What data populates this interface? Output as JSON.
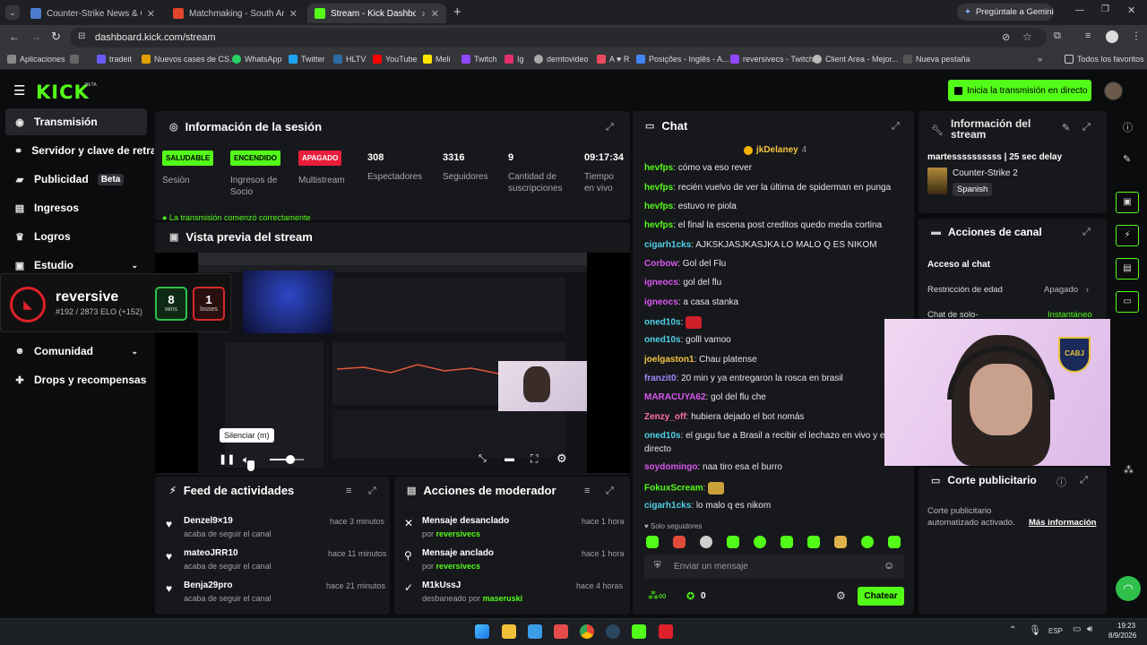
{
  "browser": {
    "tabs": [
      {
        "title": "Counter-Strike News & Coverag",
        "color": "#4a7bd0"
      },
      {
        "title": "Matchmaking - South America",
        "color": "#e0462c"
      },
      {
        "title": "Stream - Kick Dashboard",
        "color": "#53fc18"
      }
    ],
    "gemini": "Pregúntale a Gemini",
    "url": "dashboard.kick.com/stream",
    "bookmarks": [
      {
        "label": "Aplicaciones",
        "color": "#888"
      },
      {
        "label": "tradeit",
        "color": "#6a5af9"
      },
      {
        "label": "Nuevos cases de CS...",
        "color": "#e0a100"
      },
      {
        "label": "WhatsApp",
        "color": "#25d366"
      },
      {
        "label": "Twitter",
        "color": "#1da1f2"
      },
      {
        "label": "HLTV",
        "color": "#2d6da3"
      },
      {
        "label": "YouTube",
        "color": "#ff0000"
      },
      {
        "label": "Meli",
        "color": "#ffe600"
      },
      {
        "label": "Twitch",
        "color": "#9146ff"
      },
      {
        "label": "Ig",
        "color": "#e1306c"
      },
      {
        "label": "demtovideo",
        "color": "#aaaaaa"
      },
      {
        "label": "A ♥ R",
        "color": "#e84a5f"
      },
      {
        "label": "Posições - Inglês - A...",
        "color": "#4285f4"
      },
      {
        "label": "reversivecs - Twitch",
        "color": "#9146ff"
      },
      {
        "label": "Client Area - Mejor...",
        "color": "#bbbbbb"
      },
      {
        "label": "Nueva pestaña",
        "color": "#555555"
      }
    ],
    "all_bookmarks": "Todos los favoritos"
  },
  "header": {
    "logo": "KICK",
    "logo_sup": "BETA",
    "go_live": "Inicia la transmisión en directo"
  },
  "sidebar": {
    "items": [
      {
        "label": "Transmisión",
        "icon": "broadcast-icon"
      },
      {
        "label": "Servidor y clave de retransmisión",
        "icon": "link-icon"
      },
      {
        "label": "Publicidad",
        "icon": "ads-icon",
        "badge": "Beta"
      },
      {
        "label": "Ingresos",
        "icon": "revenue-icon"
      },
      {
        "label": "Logros",
        "icon": "trophy-icon"
      },
      {
        "label": "Estudio",
        "icon": "studio-icon"
      },
      {
        "label": "Comunidad",
        "icon": "community-icon"
      },
      {
        "label": "Drops y recompensas",
        "icon": "gift-icon"
      }
    ]
  },
  "faceit_overlay": {
    "name": "reversive",
    "elo": "#192 / 2873 ELO (+152)",
    "wins": "8",
    "wins_label": "wins",
    "losses": "1",
    "losses_label": "losses"
  },
  "session": {
    "title": "Información de la sesión",
    "stats": [
      {
        "pill": "SALUDABLE",
        "label": "Sesión",
        "pill_color": "#53fc18"
      },
      {
        "pill": "ENCENDIDO",
        "label": "Ingresos de Socio",
        "pill_color": "#53fc18"
      },
      {
        "pill": "APAGADO",
        "label": "Multistream",
        "pill_color": "#e91e3a"
      }
    ],
    "numbers": [
      {
        "value": "308",
        "label": "Espectadores"
      },
      {
        "value": "3316",
        "label": "Seguidores"
      },
      {
        "value": "9",
        "label": "Cantidad de suscripciones"
      },
      {
        "value": "09:17:34",
        "label": "Tiempo en vivo"
      }
    ],
    "notice": "La transmisión comenzó correctamente"
  },
  "preview": {
    "title": "Vista previa del stream",
    "tooltip": "Silenciar (m)",
    "volume": 0.6
  },
  "activity": {
    "title": "Feed de actividades",
    "items": [
      {
        "name": "Denzel9×19",
        "sub": "acaba de seguir el canal",
        "time": "hace 3 minutos"
      },
      {
        "name": "mateoJRR10",
        "sub": "acaba de seguir el canal",
        "time": "hace 11 minutos"
      },
      {
        "name": "Benja29pro",
        "sub": "acaba de seguir el canal",
        "time": "hace 21 minutos"
      }
    ]
  },
  "moderator": {
    "title": "Acciones de moderador",
    "items": [
      {
        "name": "Mensaje desanclado",
        "pre": "por ",
        "who": "reversivecs",
        "time": "hace 1 hora",
        "icon": "unpin-icon"
      },
      {
        "name": "Mensaje anclado",
        "pre": "por ",
        "who": "reversivecs",
        "time": "hace 1 hora",
        "icon": "pin-icon"
      },
      {
        "name": "M1kUssJ",
        "pre": "desbaneado por ",
        "who": "maseruski",
        "time": "hace 4 horas",
        "icon": "unban-icon"
      }
    ]
  },
  "chat": {
    "title": "Chat",
    "pinned_user": "jkDelaney",
    "pinned_count": "4",
    "messages": [
      {
        "user": "hevfps",
        "color": "#53fc18",
        "text": "cómo va eso rever"
      },
      {
        "user": "hevfps",
        "color": "#53fc18",
        "text": "recién vuelvo de ver la última de spiderman en punga"
      },
      {
        "user": "hevfps",
        "color": "#53fc18",
        "text": "estuvo re piola"
      },
      {
        "user": "hevfps",
        "color": "#53fc18",
        "text": "el final la escena post creditos quedo media cortina"
      },
      {
        "user": "cigarh1cks",
        "color": "#4fd1e8",
        "text": "AJKSKJASJKASJKA LO MALO Q ES NIKOM"
      },
      {
        "user": "Corbow",
        "color": "#d958f0",
        "text": "Gol del Flu"
      },
      {
        "user": "igneocs",
        "color": "#d958f0",
        "text": "gol del flu"
      },
      {
        "user": "igneocs",
        "color": "#d958f0",
        "text": "a casa stanka"
      },
      {
        "user": "oned10s",
        "color": "#4fd1e8",
        "text": ""
      },
      {
        "user": "oned10s",
        "color": "#4fd1e8",
        "text": "golll vamoo"
      },
      {
        "user": "joelgaston1",
        "color": "#f5c542",
        "text": "Chau platense"
      },
      {
        "user": "franzit0",
        "color": "#9b8cff",
        "text": "20 min y ya entregaron la rosca en brasil"
      },
      {
        "user": "MARACUYA62",
        "color": "#d958f0",
        "text": "gol del flu che"
      },
      {
        "user": "Zenzy_off",
        "color": "#ff6fa8",
        "text": "hubiera dejado el bot nomás"
      },
      {
        "user": "oned10s",
        "color": "#4fd1e8",
        "text": "el gugu fue a Brasil a recibir el lechazo en vivo y en"
      },
      {
        "user": "",
        "color": "#e6e6e6",
        "text": "directo"
      },
      {
        "user": "soydomingo",
        "color": "#d958f0",
        "text": "naa tiro esa el burro"
      },
      {
        "user": "FokuxScream",
        "color": "#53fc18",
        "text": ""
      },
      {
        "user": "cigarh1cks",
        "color": "#4fd1e8",
        "text": "lo malo q es nikom"
      }
    ],
    "followers_only": "Solo seguidores",
    "input_placeholder": "Enviar un mensaje",
    "points": "0",
    "send": "Chatear"
  },
  "stream_info": {
    "title": "Información del stream",
    "stream_title": "martessssssssss | 25 sec delay",
    "category": "Counter-Strike 2",
    "language": "Spanish"
  },
  "channel_actions": {
    "title": "Acciones de canal",
    "access": "Acceso al chat",
    "age_label": "Restricción de edad",
    "age_value": "Apagado",
    "chat_label": "Chat de solo-",
    "chat_value": "Instantáneo"
  },
  "ad_break": {
    "title": "Corte publicitario",
    "text": "Corte publicitario automatizado activado.",
    "link": "Más información"
  },
  "taskbar": {
    "lang": "ESP",
    "time": "19:23",
    "date": "8/9/2026"
  }
}
